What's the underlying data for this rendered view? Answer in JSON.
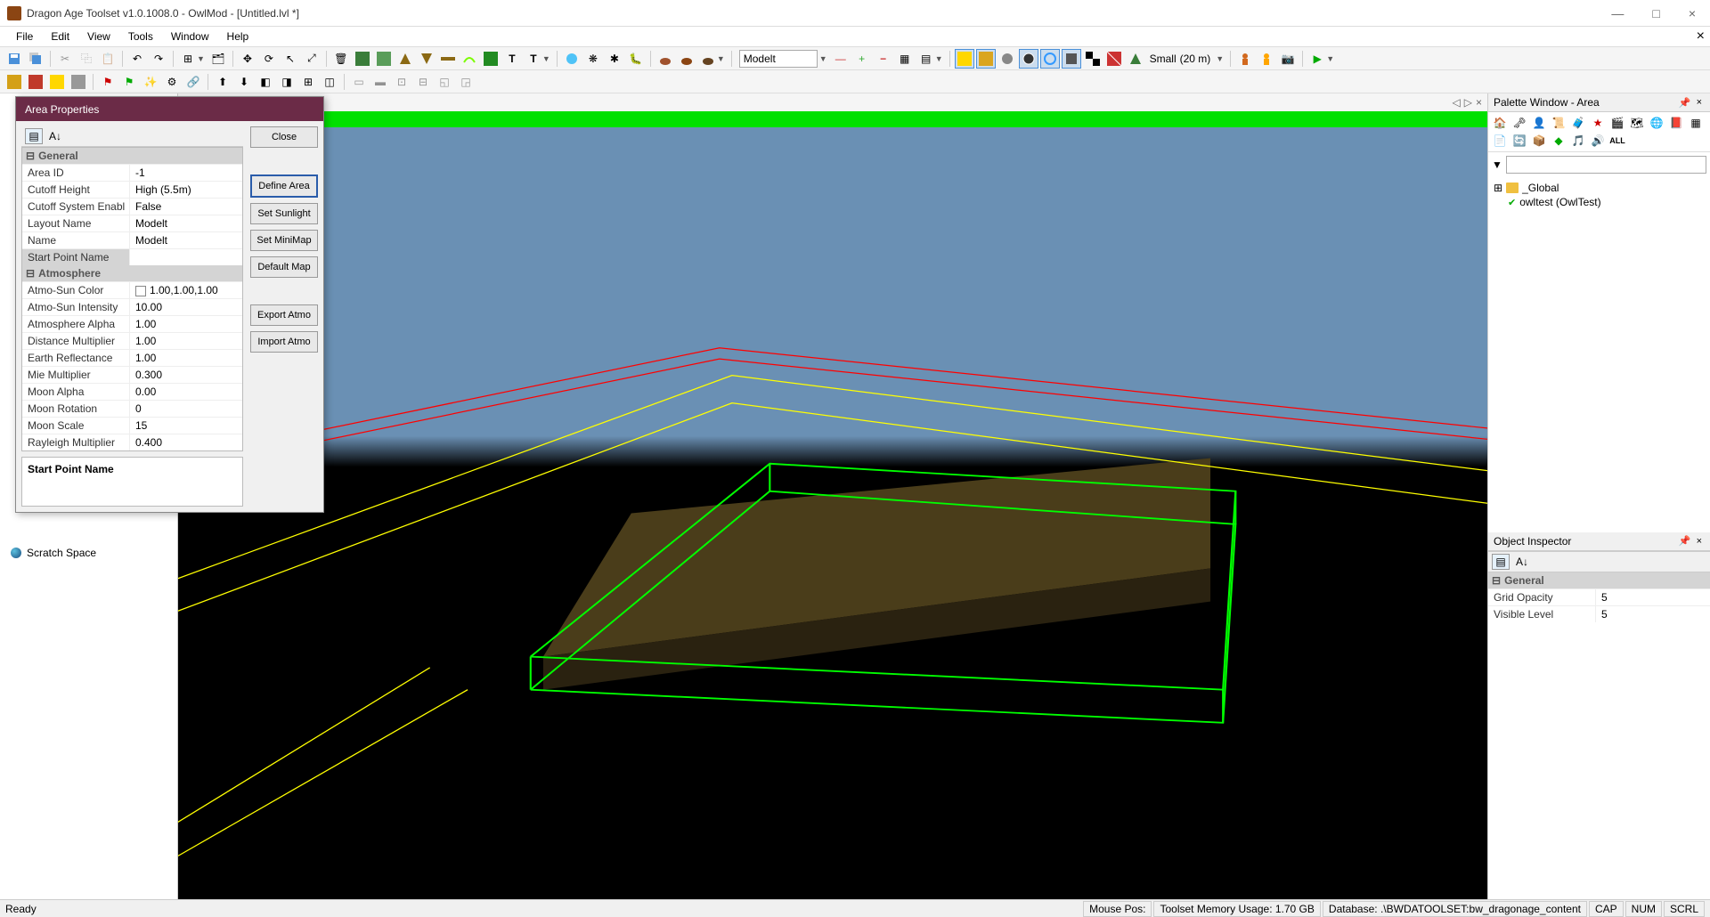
{
  "titlebar": {
    "title": "Dragon Age Toolset v1.0.1008.0 - OwlMod - [Untitled.lvl *]"
  },
  "menubar": {
    "items": [
      "File",
      "Edit",
      "View",
      "Tools",
      "Window",
      "Help"
    ]
  },
  "toolbar": {
    "combo_modelt": "Modelt",
    "grid_label": "Small",
    "grid_value": "(20 m)"
  },
  "doc_nav": {
    "left": "◁",
    "right": "▷",
    "close": "×"
  },
  "area_props": {
    "title": "Area Properties",
    "buttons": {
      "close": "Close",
      "define_area": "Define Area",
      "set_sunlight": "Set Sunlight",
      "set_minimap": "Set MiniMap",
      "default_map": "Default Map",
      "export_atmo": "Export Atmo",
      "import_atmo": "Import Atmo"
    },
    "general": {
      "cat": "General",
      "area_id_label": "Area ID",
      "area_id": "-1",
      "cutoff_height_label": "Cutoff Height",
      "cutoff_height": "High (5.5m)",
      "cutoff_system_label": "Cutoff System Enabl",
      "cutoff_system": "False",
      "layout_name_label": "Layout Name",
      "layout_name": "Modelt",
      "name_label": "Name",
      "name": "Modelt",
      "start_point_label": "Start Point Name",
      "start_point": ""
    },
    "atmosphere": {
      "cat": "Atmosphere",
      "sun_color_label": "Atmo-Sun Color",
      "sun_color": "1.00,1.00,1.00",
      "sun_intensity_label": "Atmo-Sun Intensity",
      "sun_intensity": "10.00",
      "alpha_label": "Atmosphere Alpha",
      "alpha": "1.00",
      "dist_mult_label": "Distance Multiplier",
      "dist_mult": "1.00",
      "earth_refl_label": "Earth Reflectance",
      "earth_refl": "1.00",
      "mie_label": "Mie Multiplier",
      "mie": "0.300",
      "moon_alpha_label": "Moon Alpha",
      "moon_alpha": "0.00",
      "moon_rot_label": "Moon Rotation",
      "moon_rot": "0",
      "moon_scale_label": "Moon Scale",
      "moon_scale": "15",
      "rayleigh_label": "Rayleigh Multiplier",
      "rayleigh": "0.400"
    },
    "desc_title": "Start Point Name"
  },
  "left_tree": {
    "scratch": "Scratch Space"
  },
  "palette": {
    "title": "Palette Window - Area",
    "search_placeholder": "",
    "global": "_Global",
    "owltest": "owltest (OwlTest)"
  },
  "inspector": {
    "title": "Object Inspector",
    "general": "General",
    "grid_opacity_label": "Grid Opacity",
    "grid_opacity": "5",
    "visible_level_label": "Visible Level",
    "visible_level": "5"
  },
  "statusbar": {
    "ready": "Ready",
    "mouse_pos": "Mouse Pos:",
    "memory": "Toolset Memory Usage: 1.70 GB",
    "database": "Database: .\\BWDATOOLSET:bw_dragonage_content",
    "cap": "CAP",
    "num": "NUM",
    "scrl": "SCRL"
  }
}
